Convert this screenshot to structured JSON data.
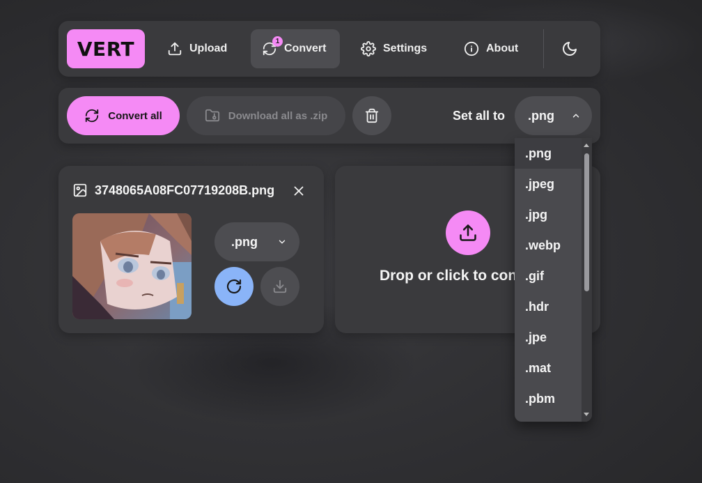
{
  "nav": {
    "logo": "VERT",
    "items": [
      {
        "label": "Upload",
        "icon": "upload-icon"
      },
      {
        "label": "Convert",
        "icon": "convert-icon",
        "badge": "1",
        "active": true
      },
      {
        "label": "Settings",
        "icon": "gear-icon"
      },
      {
        "label": "About",
        "icon": "info-icon"
      }
    ],
    "theme_icon": "moon-icon"
  },
  "toolbar": {
    "convert_all": "Convert all",
    "download_zip": "Download all as .zip",
    "set_all_label": "Set all to",
    "set_all_value": ".png"
  },
  "file": {
    "name": "3748065A08FC07719208B.png",
    "format": ".png"
  },
  "drop_zone": {
    "text": "Drop or click to convert"
  },
  "dropdown": {
    "options": [
      ".png",
      ".jpeg",
      ".jpg",
      ".webp",
      ".gif",
      ".hdr",
      ".jpe",
      ".mat",
      ".pbm"
    ],
    "selected": ".png"
  },
  "colors": {
    "accent": "#f58af5",
    "blue": "#8ab4f8",
    "panel": "#3a3a3d"
  }
}
